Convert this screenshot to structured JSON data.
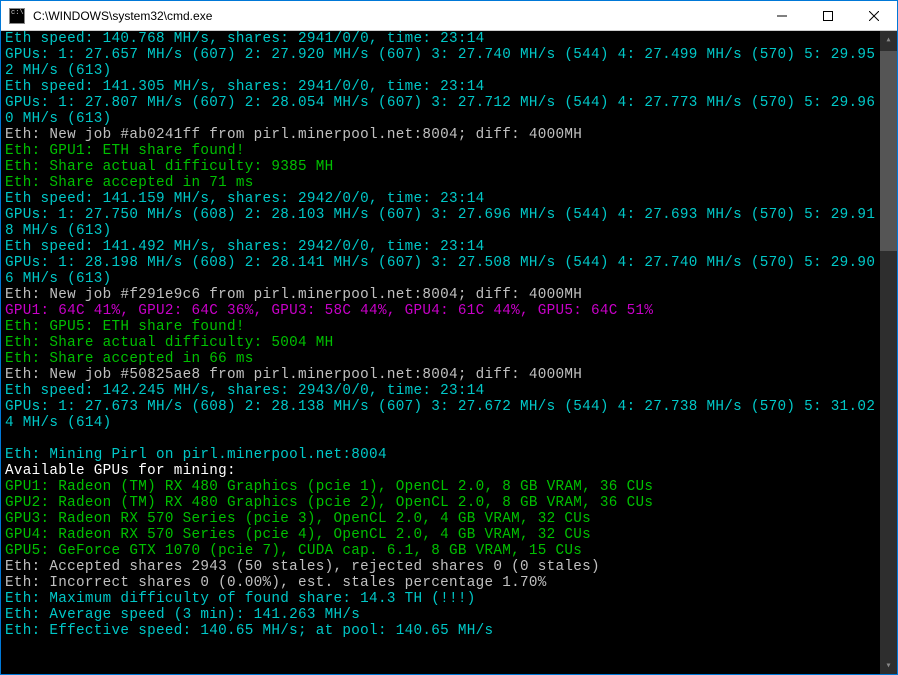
{
  "titlebar": {
    "title": "C:\\WINDOWS\\system32\\cmd.exe"
  },
  "lines": [
    {
      "color": "cyan",
      "text": "Eth speed: 140.768 MH/s, shares: 2941/0/0, time: 23:14"
    },
    {
      "color": "cyan",
      "text": "GPUs: 1: 27.657 MH/s (607) 2: 27.920 MH/s (607) 3: 27.740 MH/s (544) 4: 27.499 MH/s (570) 5: 29.952 MH/s (613)"
    },
    {
      "color": "cyan",
      "text": "Eth speed: 141.305 MH/s, shares: 2941/0/0, time: 23:14"
    },
    {
      "color": "cyan",
      "text": "GPUs: 1: 27.807 MH/s (607) 2: 28.054 MH/s (607) 3: 27.712 MH/s (544) 4: 27.773 MH/s (570) 5: 29.960 MH/s (613)"
    },
    {
      "color": "gray",
      "text": "Eth: New job #ab0241ff from pirl.minerpool.net:8004; diff: 4000MH"
    },
    {
      "color": "green",
      "text": "Eth: GPU1: ETH share found!"
    },
    {
      "color": "green",
      "text": "Eth: Share actual difficulty: 9385 MH"
    },
    {
      "color": "green",
      "text": "Eth: Share accepted in 71 ms"
    },
    {
      "color": "cyan",
      "text": "Eth speed: 141.159 MH/s, shares: 2942/0/0, time: 23:14"
    },
    {
      "color": "cyan",
      "text": "GPUs: 1: 27.750 MH/s (608) 2: 28.103 MH/s (607) 3: 27.696 MH/s (544) 4: 27.693 MH/s (570) 5: 29.918 MH/s (613)"
    },
    {
      "color": "cyan",
      "text": "Eth speed: 141.492 MH/s, shares: 2942/0/0, time: 23:14"
    },
    {
      "color": "cyan",
      "text": "GPUs: 1: 28.198 MH/s (608) 2: 28.141 MH/s (607) 3: 27.508 MH/s (544) 4: 27.740 MH/s (570) 5: 29.906 MH/s (613)"
    },
    {
      "color": "gray",
      "text": "Eth: New job #f291e9c6 from pirl.minerpool.net:8004; diff: 4000MH"
    },
    {
      "color": "magenta",
      "text": "GPU1: 64C 41%, GPU2: 64C 36%, GPU3: 58C 44%, GPU4: 61C 44%, GPU5: 64C 51%"
    },
    {
      "color": "green",
      "text": "Eth: GPU5: ETH share found!"
    },
    {
      "color": "green",
      "text": "Eth: Share actual difficulty: 5004 MH"
    },
    {
      "color": "green",
      "text": "Eth: Share accepted in 66 ms"
    },
    {
      "color": "gray",
      "text": "Eth: New job #50825ae8 from pirl.minerpool.net:8004; diff: 4000MH"
    },
    {
      "color": "cyan",
      "text": "Eth speed: 142.245 MH/s, shares: 2943/0/0, time: 23:14"
    },
    {
      "color": "cyan",
      "text": "GPUs: 1: 27.673 MH/s (608) 2: 28.138 MH/s (607) 3: 27.672 MH/s (544) 4: 27.738 MH/s (570) 5: 31.024 MH/s (614)"
    },
    {
      "color": "cyan",
      "text": ""
    },
    {
      "color": "cyan",
      "text": "Eth: Mining Pirl on pirl.minerpool.net:8004"
    },
    {
      "color": "white",
      "text": "Available GPUs for mining:"
    },
    {
      "color": "green",
      "text": "GPU1: Radeon (TM) RX 480 Graphics (pcie 1), OpenCL 2.0, 8 GB VRAM, 36 CUs"
    },
    {
      "color": "green",
      "text": "GPU2: Radeon (TM) RX 480 Graphics (pcie 2), OpenCL 2.0, 8 GB VRAM, 36 CUs"
    },
    {
      "color": "green",
      "text": "GPU3: Radeon RX 570 Series (pcie 3), OpenCL 2.0, 4 GB VRAM, 32 CUs"
    },
    {
      "color": "green",
      "text": "GPU4: Radeon RX 570 Series (pcie 4), OpenCL 2.0, 4 GB VRAM, 32 CUs"
    },
    {
      "color": "green",
      "text": "GPU5: GeForce GTX 1070 (pcie 7), CUDA cap. 6.1, 8 GB VRAM, 15 CUs"
    },
    {
      "color": "gray",
      "text": "Eth: Accepted shares 2943 (50 stales), rejected shares 0 (0 stales)"
    },
    {
      "color": "gray",
      "text": "Eth: Incorrect shares 0 (0.00%), est. stales percentage 1.70%"
    },
    {
      "color": "cyan",
      "text": "Eth: Maximum difficulty of found share: 14.3 TH (!!!)"
    },
    {
      "color": "cyan",
      "text": "Eth: Average speed (3 min): 141.263 MH/s"
    },
    {
      "color": "cyan",
      "text": "Eth: Effective speed: 140.65 MH/s; at pool: 140.65 MH/s"
    }
  ]
}
